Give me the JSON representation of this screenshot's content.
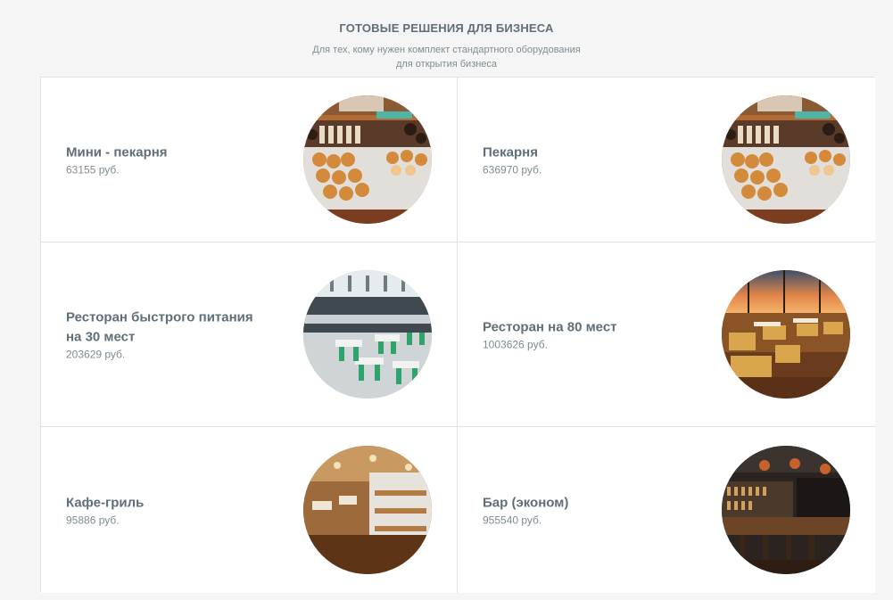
{
  "header": {
    "title": "ГОТОВЫЕ РЕШЕНИЯ ДЛЯ БИЗНЕСА",
    "subtitle_line1": "Для тех, кому нужен комплект стандартного оборудования",
    "subtitle_line2": "для открытия бизнеса"
  },
  "items": [
    {
      "name": "Мини - пекарня",
      "price": "63155 руб.",
      "image": "bakery-pastries-photo"
    },
    {
      "name": "Пекарня",
      "price": "636970 руб.",
      "image": "bakery-pastries-photo"
    },
    {
      "name": "Ресторан быстрого питания на 30 мест",
      "price": "203629 руб.",
      "image": "fast-food-hall-photo"
    },
    {
      "name": "Ресторан на 80 мест",
      "price": "1003626 руб.",
      "image": "restaurant-sunset-photo"
    },
    {
      "name": "Кафе-гриль",
      "price": "95886 руб.",
      "image": "cafe-interior-photo"
    },
    {
      "name": "Бар (эконом)",
      "price": "955540 руб.",
      "image": "bar-interior-photo"
    }
  ]
}
